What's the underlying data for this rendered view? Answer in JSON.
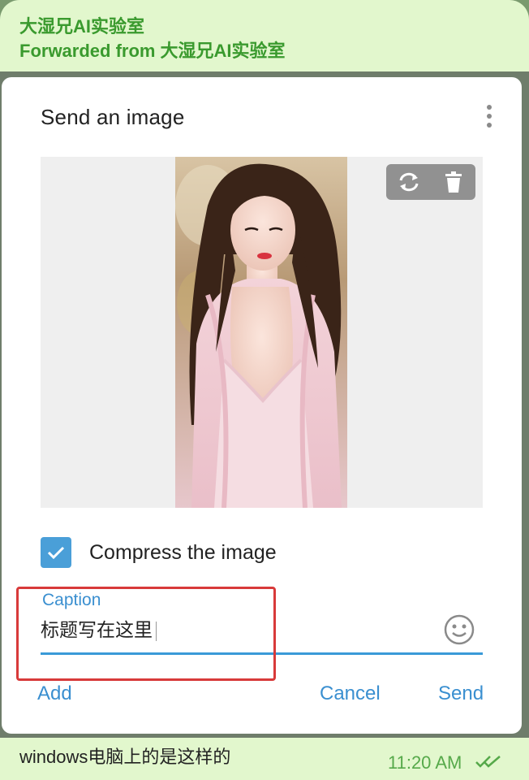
{
  "message": {
    "channel_name": "大湿兄AI实验室",
    "forwarded_prefix": "Forwarded from",
    "forwarded_source": "大湿兄AI实验室",
    "text": "windows电脑上的是这样的",
    "time": "11:20 AM",
    "status_icon": "double-check-icon"
  },
  "dialog": {
    "title": "Send an image",
    "menu_icon": "more-vertical-icon",
    "image_tools": [
      "replace-icon",
      "delete-icon"
    ],
    "compress_label": "Compress the image",
    "compress_checked": true,
    "caption_label": "Caption",
    "caption_value": "标题写在这里",
    "emoji_icon": "smiley-icon",
    "buttons": {
      "add": "Add",
      "cancel": "Cancel",
      "send": "Send"
    }
  },
  "colors": {
    "accent": "#3a8fd0",
    "forward_green": "#3a9a2e",
    "bubble_bg": "#e2f7cd",
    "highlight_red": "#d83a3a"
  }
}
